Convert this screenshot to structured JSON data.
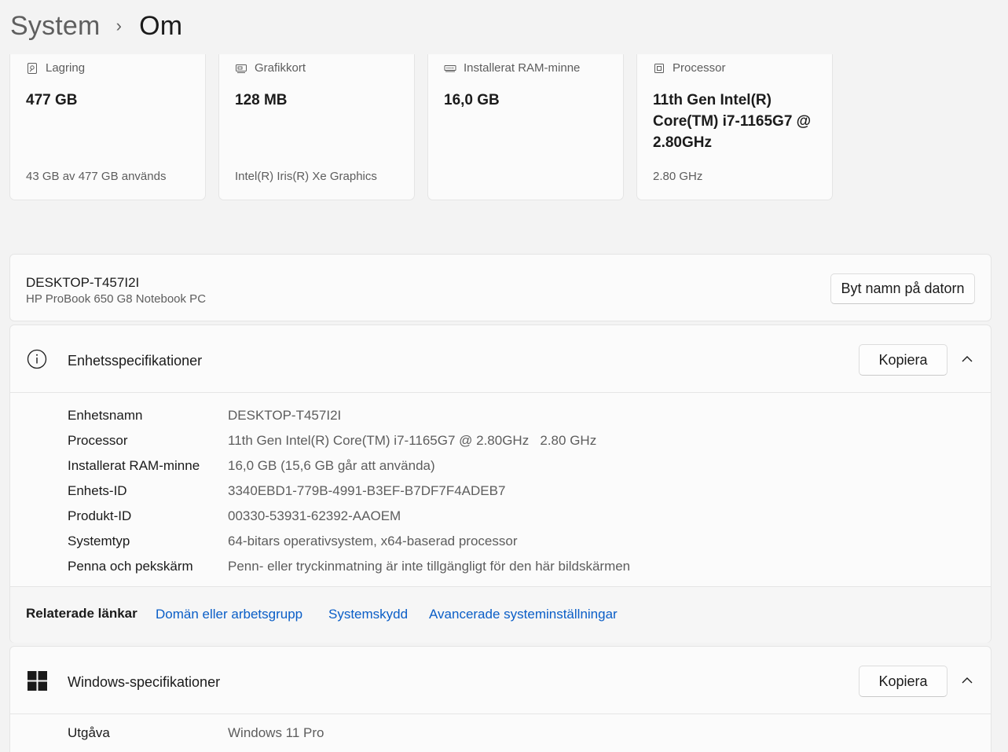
{
  "breadcrumb": {
    "parent": "System",
    "separator": "›",
    "current": "Om"
  },
  "cards": [
    {
      "label": "Lagring",
      "icon": "storage-icon",
      "value": "477 GB",
      "sub": "43 GB av 477 GB används"
    },
    {
      "label": "Grafikkort",
      "icon": "graphics-card-icon",
      "value": "128 MB",
      "sub": "Intel(R) Iris(R) Xe Graphics"
    },
    {
      "label": "Installerat RAM-minne",
      "icon": "ram-icon",
      "value": "16,0 GB",
      "sub": ""
    },
    {
      "label": "Processor",
      "icon": "processor-icon",
      "value": "11th Gen Intel(R) Core(TM) i7-1165G7 @ 2.80GHz",
      "sub": "2.80 GHz"
    }
  ],
  "device": {
    "name": "DESKTOP-T457I2I",
    "model": "HP ProBook 650 G8 Notebook PC",
    "rename_label": "Byt namn på datorn"
  },
  "device_specs": {
    "title": "Enhetsspecifikationer",
    "copy_label": "Kopiera",
    "rows": [
      {
        "label": "Enhetsnamn",
        "value": "DESKTOP-T457I2I"
      },
      {
        "label": "Processor",
        "value": "11th Gen Intel(R) Core(TM) i7-1165G7 @ 2.80GHz   2.80 GHz"
      },
      {
        "label": "Installerat RAM-minne",
        "value": "16,0 GB (15,6 GB går att använda)"
      },
      {
        "label": "Enhets-ID",
        "value": "3340EBD1-779B-4991-B3EF-B7DF7F4ADEB7"
      },
      {
        "label": "Produkt-ID",
        "value": "00330-53931-62392-AAOEM"
      },
      {
        "label": "Systemtyp",
        "value": "64-bitars operativsystem, x64-baserad processor"
      },
      {
        "label": "Penna och pekskärm",
        "value": "Penn- eller tryckinmatning är inte tillgängligt för den här bildskärmen"
      }
    ]
  },
  "related": {
    "title": "Relaterade länkar",
    "links": [
      "Domän eller arbetsgrupp",
      "Systemskydd",
      "Avancerade systeminställningar"
    ]
  },
  "windows_specs": {
    "title": "Windows-specifikationer",
    "copy_label": "Kopiera",
    "rows": [
      {
        "label": "Utgåva",
        "value": "Windows 11 Pro"
      }
    ]
  },
  "colors": {
    "accent_link": "#0a5ec7",
    "background": "#f3f3f3",
    "card": "#fbfbfb"
  }
}
